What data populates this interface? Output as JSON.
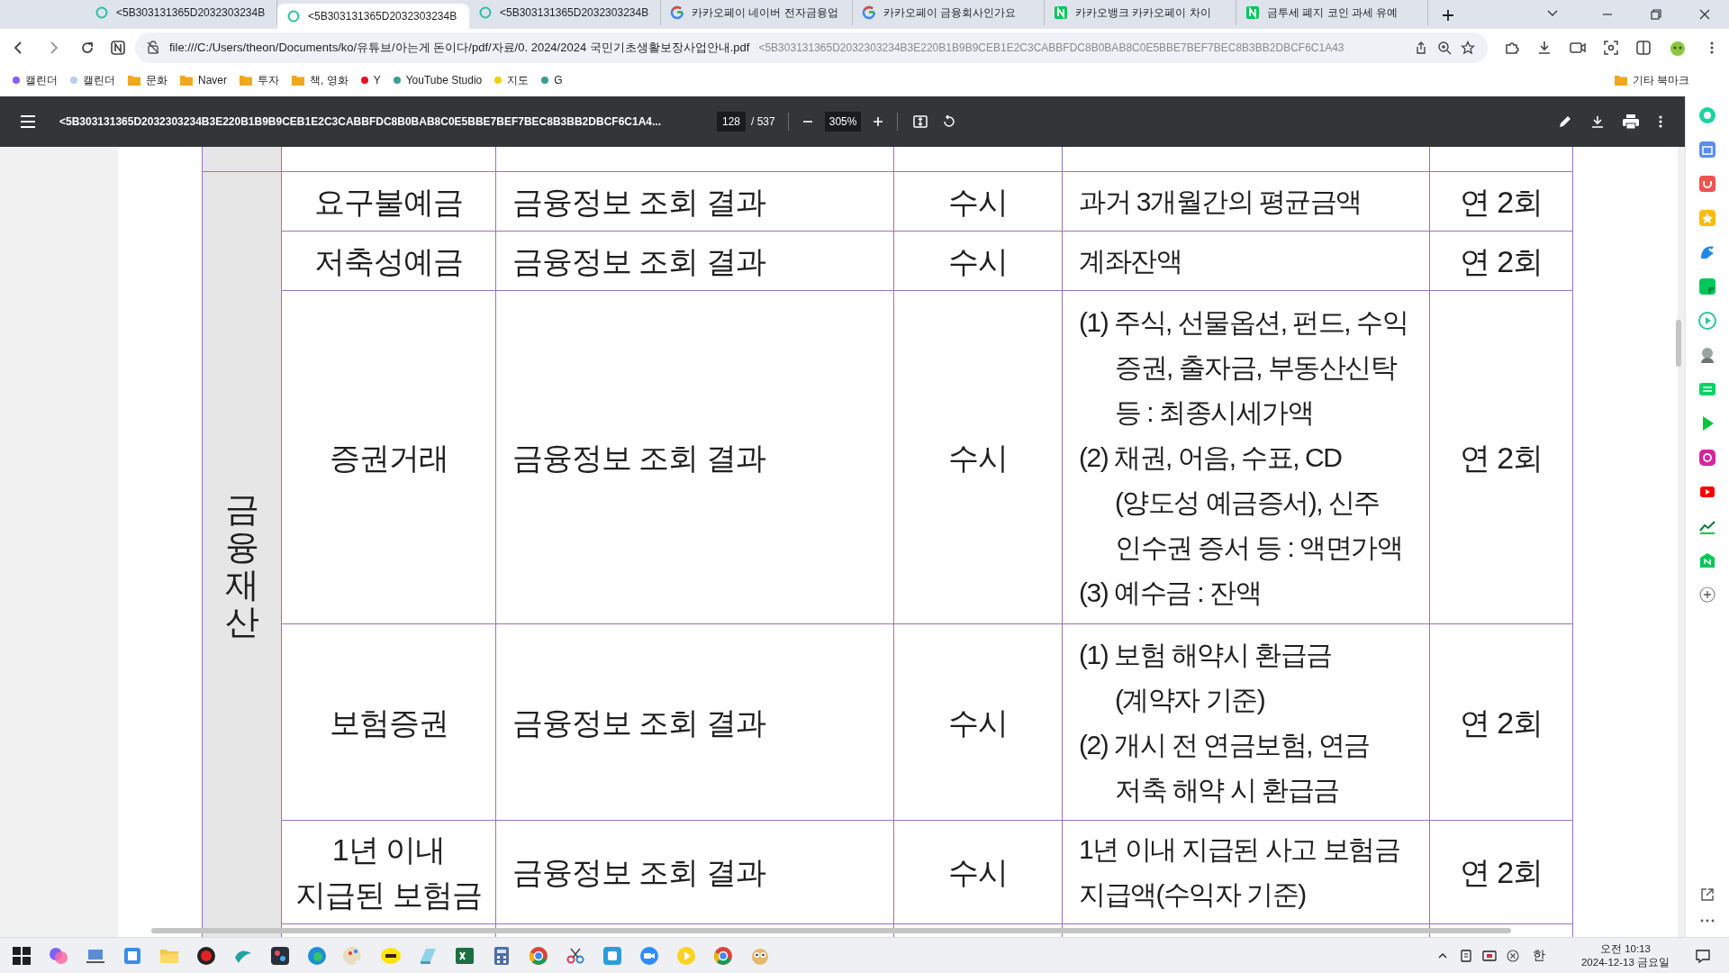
{
  "tabs": [
    {
      "title": "<5B303131365D2032303234B",
      "kind": "page",
      "selected": false
    },
    {
      "title": "<5B303131365D2032303234B",
      "kind": "page",
      "selected": true
    },
    {
      "title": "<5B303131365D2032303234B",
      "kind": "page",
      "selected": false
    },
    {
      "title": "카카오페이 네이버 전자금융업",
      "kind": "google",
      "selected": false
    },
    {
      "title": "카카오페이 금융회사인가요",
      "kind": "google",
      "selected": false
    },
    {
      "title": "카카오뱅크 카카오페이 차이",
      "kind": "naver",
      "selected": false
    },
    {
      "title": "금투세 폐지 코인 과세 유예",
      "kind": "naver",
      "selected": false
    }
  ],
  "address": {
    "url": "file:///C:/Users/theon/Documents/ko/유튜브/아는게 돈이다/pdf/자료/0. 2024/2024 국민기초생활보장사업안내.pdf",
    "suffix": "<5B303131365D2032303234B3E220B1B9B9CEB1E2C3CABBFDC8B0BAB8C0E5BBE7BEF7BEC8B3BB2DBCF6C1A43"
  },
  "bookmarks": [
    {
      "label": "캘린더",
      "kind": "dot",
      "color": "#8b5cf6"
    },
    {
      "label": "캘린더",
      "kind": "dot",
      "color": "#b9cdee"
    },
    {
      "label": "문화",
      "kind": "folder"
    },
    {
      "label": "Naver",
      "kind": "folder"
    },
    {
      "label": "투자",
      "kind": "folder"
    },
    {
      "label": "책, 영화",
      "kind": "folder"
    },
    {
      "label": "Y",
      "kind": "dot",
      "color": "#e81123"
    },
    {
      "label": "YouTube Studio",
      "kind": "dot",
      "color": "#3a9e94"
    },
    {
      "label": "지도",
      "kind": "dot",
      "color": "#f2d200"
    },
    {
      "label": "G",
      "kind": "dot",
      "color": "#3a9e94"
    }
  ],
  "other_bookmarks": "기타 북마크",
  "pdf_toolbar": {
    "title": "<5B303131365D2032303234B3E220B1B9B9CEB1E2C3CABBFDC8B0BAB8C0E5BBE7BEF7BEC8B3BB2DBCF6C1A4...",
    "page": "128",
    "total": "/ 537",
    "zoom": "305%"
  },
  "table": {
    "section": "금융재산",
    "rows": [
      {
        "item": "요구불예금",
        "source": "금융정보 조회 결과",
        "timing": "수시",
        "criteria": [
          {
            "kind": "plain",
            "text": "과거 3개월간의 평균금액"
          }
        ],
        "frequency": "연 2회"
      },
      {
        "item": "저축성예금",
        "source": "금융정보 조회 결과",
        "timing": "수시",
        "criteria": [
          {
            "kind": "plain",
            "text": "계좌잔액"
          }
        ],
        "frequency": "연 2회"
      },
      {
        "item": "증권거래",
        "source": "금융정보 조회 결과",
        "timing": "수시",
        "criteria": [
          {
            "kind": "numbered",
            "text": "(1) 주식, 선물옵션, 펀드, 수익\n증권, 출자금, 부동산신탁\n등 : 최종시세가액"
          },
          {
            "kind": "numbered",
            "text": "(2) 채권, 어음, 수표, CD\n(양도성 예금증서), 신주\n인수권 증서 등 : 액면가액"
          },
          {
            "kind": "plain",
            "text": "(3) 예수금 : 잔액"
          }
        ],
        "frequency": "연 2회"
      },
      {
        "item": "보험증권",
        "source": "금융정보 조회 결과",
        "timing": "수시",
        "criteria": [
          {
            "kind": "numbered",
            "text": "(1) 보험 해약시 환급금\n(계약자 기준)"
          },
          {
            "kind": "numbered",
            "text": "(2) 개시 전 연금보험, 연금\n저축 해약 시 환급금"
          }
        ],
        "frequency": "연 2회"
      },
      {
        "item": "1년 이내\n지급된 보험금",
        "source": "금융정보 조회 결과",
        "timing": "수시",
        "criteria": [
          {
            "kind": "plain",
            "text": "1년 이내 지급된 사고 보험금\n지급액(수익자 기준)"
          }
        ],
        "frequency": "연 2회"
      }
    ]
  },
  "taskbar": {
    "time": "오전 10:13",
    "date": "2024-12-13 금요일",
    "ime": "한"
  }
}
